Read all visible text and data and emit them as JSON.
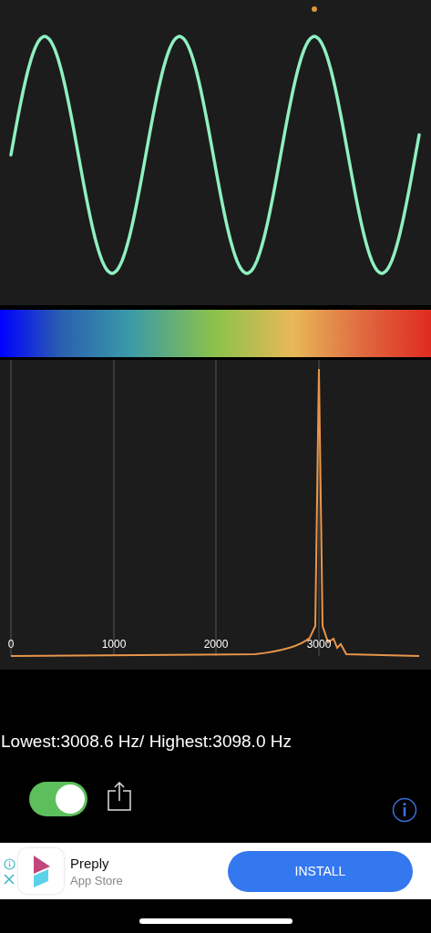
{
  "spectrum": {
    "axis_labels": [
      "0",
      "1000",
      "2000",
      "3000"
    ]
  },
  "readout": "Lowest:3008.6 Hz/ Highest:3098.0 Hz",
  "controls": {
    "toggle": {
      "on": true
    }
  },
  "ad": {
    "title": "Preply",
    "subtitle": "App Store",
    "button": "INSTALL"
  }
}
